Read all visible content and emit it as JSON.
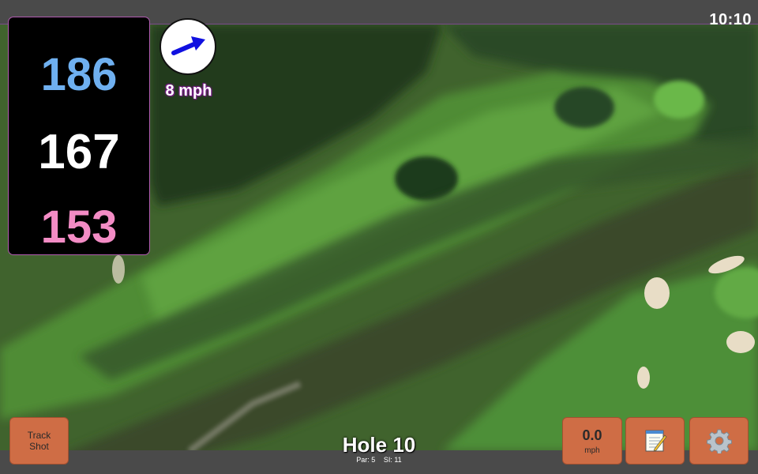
{
  "status_bar": {
    "clock": "10:10"
  },
  "distances": {
    "back": "186",
    "middle": "167",
    "front": "153"
  },
  "wind": {
    "speed_label": "8 mph",
    "direction_icon": "arrow-right-icon"
  },
  "hole": {
    "title": "Hole 10",
    "par_label": "Par: 5",
    "si_label": "SI: 11"
  },
  "buttons": {
    "track_shot_line1": "Track",
    "track_shot_line2": "Shot",
    "speed_value": "0.0",
    "speed_unit": "mph",
    "notes_icon": "notepad-icon",
    "settings_icon": "gear-icon"
  },
  "colors": {
    "back_distance": "#6fb0f0",
    "middle_distance": "#ffffff",
    "front_distance": "#f38cc5",
    "button_bg": "#cf6d45",
    "wind_arrow": "#1010e0"
  }
}
